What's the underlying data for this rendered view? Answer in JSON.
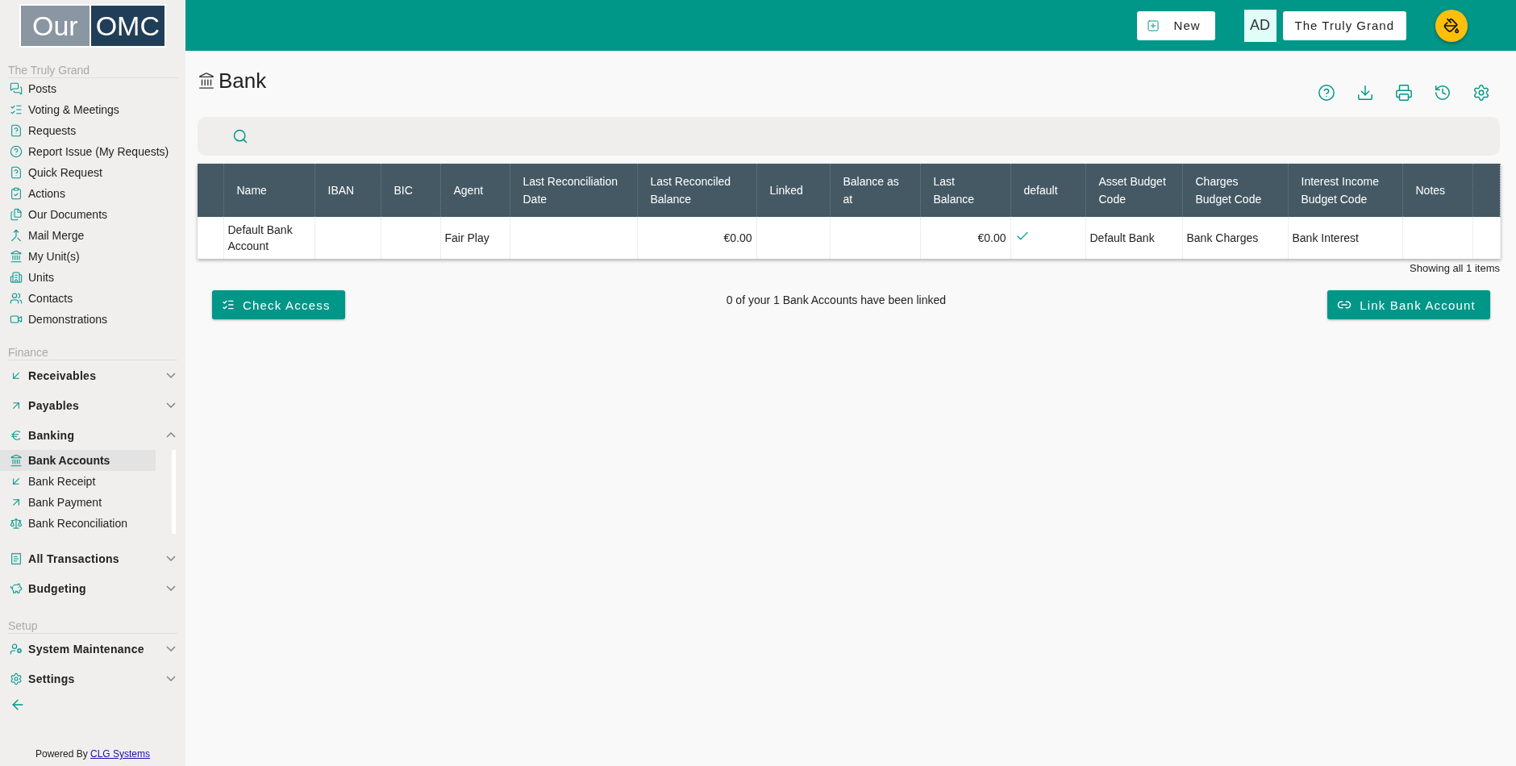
{
  "logo": {
    "left": "Our",
    "right": "OMC"
  },
  "sidebar": {
    "sections": [
      {
        "title": "The Truly Grand",
        "items": [
          {
            "kind": "link",
            "label": "Posts",
            "selected": false
          },
          {
            "kind": "link",
            "label": "Voting & Meetings",
            "selected": false
          },
          {
            "kind": "link",
            "label": "Requests",
            "selected": false
          },
          {
            "kind": "link",
            "label": "Report Issue (My Requests)",
            "selected": false
          },
          {
            "kind": "link",
            "label": "Quick Request",
            "selected": false
          },
          {
            "kind": "link",
            "label": "Actions",
            "selected": false
          },
          {
            "kind": "link",
            "label": "Our Documents",
            "selected": false
          },
          {
            "kind": "link",
            "label": "Mail Merge",
            "selected": false
          },
          {
            "kind": "link",
            "label": "My Unit(s)",
            "selected": false
          },
          {
            "kind": "link",
            "label": "Units",
            "selected": false
          },
          {
            "kind": "link",
            "label": "Contacts",
            "selected": false
          },
          {
            "kind": "link",
            "label": "Demonstrations",
            "selected": false
          }
        ]
      },
      {
        "title": "Finance",
        "items": [
          {
            "kind": "group",
            "label": "Receivables",
            "expanded": false
          },
          {
            "kind": "group",
            "label": "Payables",
            "expanded": false
          },
          {
            "kind": "group",
            "label": "Banking",
            "expanded": true,
            "children": [
              {
                "label": "Bank Accounts",
                "selected": true
              },
              {
                "label": "Bank Receipt",
                "selected": false
              },
              {
                "label": "Bank Payment",
                "selected": false
              },
              {
                "label": "Bank Reconciliation",
                "selected": false
              }
            ]
          },
          {
            "kind": "group",
            "label": "All Transactions",
            "expanded": false
          },
          {
            "kind": "group",
            "label": "Budgeting",
            "expanded": false
          }
        ]
      },
      {
        "title": "Setup",
        "items": [
          {
            "kind": "group",
            "label": "System Maintenance",
            "expanded": false
          },
          {
            "kind": "group",
            "label": "Settings",
            "expanded": false
          }
        ]
      }
    ],
    "footer": {
      "text": "Powered By",
      "link": "CLG Systems"
    }
  },
  "topbar": {
    "new_button": "New",
    "avatar": "AD",
    "org_button": "The Truly Grand"
  },
  "page": {
    "title": "Bank"
  },
  "table": {
    "columns": [
      "",
      "Name",
      "IBAN",
      "BIC",
      "Agent",
      "Last Reconciliation Date",
      "Last Reconciled Balance",
      "Linked",
      "Balance as at",
      "Last Balance",
      "default",
      "Asset Budget Code",
      "Charges Budget Code",
      "Interest Income Budget Code",
      "Notes",
      ""
    ],
    "rows": [
      {
        "cells": [
          "",
          "Default Bank Account",
          "",
          "",
          "Fair Play",
          "",
          "€0.00",
          "",
          "",
          "€0.00",
          "",
          "Default Bank",
          "Bank Charges",
          "Bank Interest",
          "",
          ""
        ],
        "default": true
      }
    ],
    "footer": "Showing all 1 items"
  },
  "actions": {
    "check_access": "Check Access",
    "status": "0 of your 1 Bank Accounts have been linked",
    "link_button": "Link Bank Account"
  }
}
